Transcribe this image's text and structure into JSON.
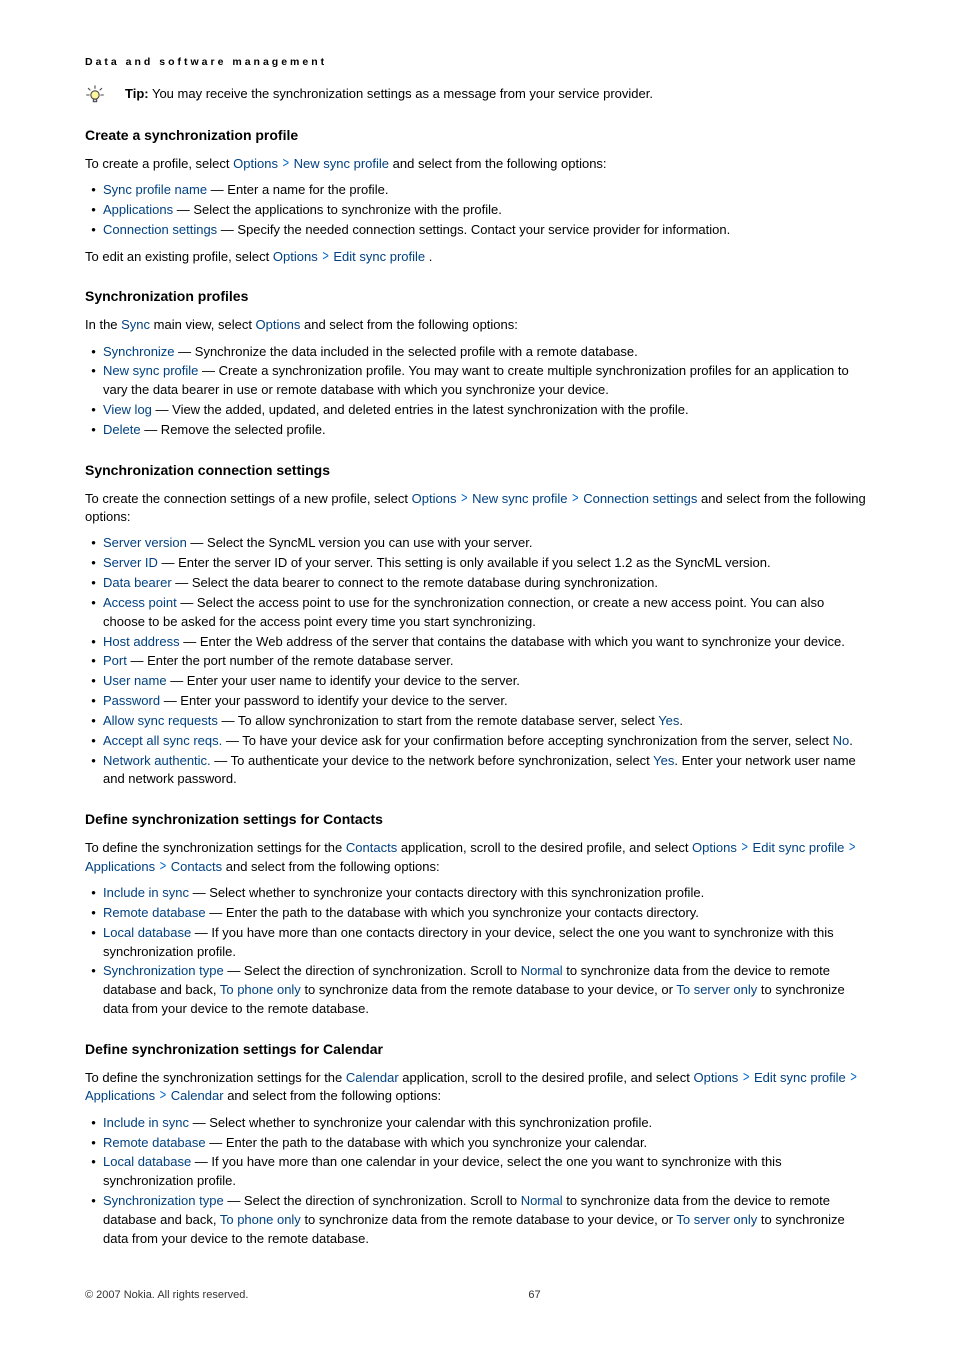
{
  "header": "Data and software management",
  "tip": {
    "label": "Tip:",
    "text": "  You may receive the synchronization settings as a message from your service provider."
  },
  "s1": {
    "title": "Create a synchronization profile",
    "intro_1": "To create a profile, select ",
    "intro_link_options": "Options",
    "intro_link_newprofile": "New sync profile",
    "intro_2": " and select from the following options:",
    "items": [
      {
        "name": "Sync profile name",
        "desc": "  — Enter a name for the profile."
      },
      {
        "name": "Applications",
        "desc": " — Select the applications to synchronize with the profile."
      },
      {
        "name": "Connection settings",
        "desc": " — Specify the needed connection settings. Contact your service provider for information."
      }
    ],
    "edit_1": "To edit an existing profile, select ",
    "edit_link_options": "Options",
    "edit_link_editprofile": "Edit sync profile",
    "edit_2": "."
  },
  "s2": {
    "title": "Synchronization profiles",
    "intro_1": "In the ",
    "intro_link_sync": "Sync",
    "intro_2": " main view, select ",
    "intro_link_options": "Options",
    "intro_3": " and select from the following options:",
    "items": [
      {
        "name": "Synchronize",
        "desc": " — Synchronize the data included in the selected profile with a remote database."
      },
      {
        "name": "New sync profile",
        "desc": " — Create a synchronization profile. You may want to create multiple synchronization profiles for an application to vary the data bearer in use or remote database with which you synchronize your device."
      },
      {
        "name": "View log",
        "desc": " — View the added, updated, and deleted entries in the latest synchronization with the profile."
      },
      {
        "name": "Delete",
        "desc": " — Remove the selected profile."
      }
    ]
  },
  "s3": {
    "title": "Synchronization connection settings",
    "intro_1": "To create the connection settings of a new profile, select ",
    "l1": "Options",
    "l2": "New sync profile",
    "l3": "Connection settings",
    "intro_2": " and select from the following options:",
    "items": [
      {
        "name": "Server version",
        "desc": " — Select the SyncML version you can use with your server."
      },
      {
        "name": "Server ID",
        "desc": " — Enter the server ID of your server. This setting is only available if you select 1.2 as the SyncML version."
      },
      {
        "name": "Data bearer",
        "desc": " — Select the data bearer to connect to the remote database during synchronization."
      },
      {
        "name": "Access point",
        "desc": " — Select the access point to use for the synchronization connection, or create a new access point. You can also choose to be asked for the access point every time you start synchronizing."
      },
      {
        "name": "Host address",
        "desc": " — Enter the Web address of the server that contains the database with which you want to synchronize your device."
      },
      {
        "name": "Port",
        "desc": " — Enter the port number of the remote database server."
      },
      {
        "name": "User name",
        "desc": " — Enter your user name to identify your device to the server."
      },
      {
        "name": "Password",
        "desc": " — Enter your password to identify your device to the server."
      }
    ],
    "i_allow": {
      "name": "Allow sync requests",
      "a": " — To allow synchronization to start from the remote database server, select ",
      "v": "Yes",
      "b": "."
    },
    "i_accept": {
      "name": "Accept all sync reqs.",
      "a": " — To have your device ask for your confirmation before accepting synchronization from the server, select ",
      "v": "No",
      "b": "."
    },
    "i_net": {
      "name": "Network authentic.",
      "a": " — To authenticate your device to the network before synchronization, select ",
      "v": "Yes",
      "b": ". Enter your network user name and network password."
    }
  },
  "s4": {
    "title": "Define synchronization settings for Contacts",
    "intro_1": "To define the synchronization settings for the ",
    "intro_contacts": "Contacts",
    "intro_2": " application, scroll to the desired profile, and select ",
    "l1": "Options",
    "l2": "Edit sync profile",
    "l3": "Applications",
    "l4": "Contacts",
    "intro_3": " and select from the following options:",
    "items": [
      {
        "name": "Include in sync",
        "desc": " — Select whether to synchronize your contacts directory with this synchronization profile."
      },
      {
        "name": "Remote database",
        "desc": " — Enter the path to the database with which you synchronize your contacts directory."
      },
      {
        "name": "Local database",
        "desc": " — If you have more than one contacts directory in your device, select the one you want to synchronize with this synchronization profile."
      }
    ],
    "synctype": {
      "name": "Synchronization type",
      "a": " — Select the direction of synchronization. Scroll to ",
      "v1": "Normal",
      "b": " to synchronize data from the device to remote database and back, ",
      "v2": "To phone only",
      "c": " to synchronize data from the remote database to your device, or ",
      "v3": "To server only",
      "d": " to synchronize data from your device to the remote database."
    }
  },
  "s5": {
    "title": "Define synchronization settings for Calendar",
    "intro_1": "To define the synchronization settings for the ",
    "intro_cal": "Calendar",
    "intro_2": " application, scroll to the desired profile, and select ",
    "l1": "Options",
    "l2": "Edit sync profile",
    "l3": "Applications",
    "l4": "Calendar",
    "intro_3": " and select from the following options:",
    "items": [
      {
        "name": "Include in sync",
        "desc": " — Select whether to synchronize your calendar with this synchronization profile."
      },
      {
        "name": "Remote database",
        "desc": " — Enter the path to the database with which you synchronize your calendar."
      },
      {
        "name": "Local database",
        "desc": " — If you have more than one calendar in your device, select the one you want to synchronize with this synchronization profile."
      }
    ],
    "synctype": {
      "name": "Synchronization type",
      "a": " — Select the direction of synchronization. Scroll to ",
      "v1": "Normal",
      "b": " to synchronize data from the device to remote database and back, ",
      "v2": "To phone only",
      "c": " to synchronize data from the remote database to your device, or ",
      "v3": "To server only",
      "d": " to synchronize data from your device to the remote database."
    }
  },
  "footer": {
    "copyright": "© 2007 Nokia. All rights reserved.",
    "pageno": "67"
  }
}
